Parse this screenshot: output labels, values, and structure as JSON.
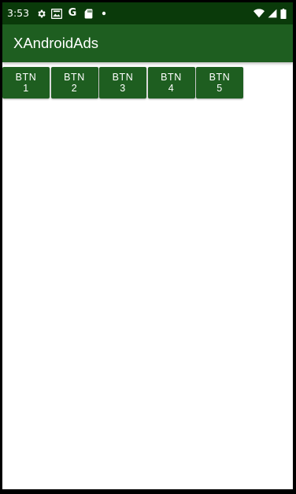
{
  "status_bar": {
    "time": "3:53",
    "left_icons": [
      "gear-icon",
      "gallery-icon",
      "google-icon",
      "sd-card-icon",
      "dot-icon"
    ],
    "right_icons": [
      "wifi-icon",
      "cell-signal-icon",
      "battery-icon"
    ],
    "google_glyph": "G"
  },
  "app_bar": {
    "title": "XAndroidAds"
  },
  "buttons": [
    {
      "line1": "BTN",
      "line2": "1"
    },
    {
      "line1": "BTN",
      "line2": "2"
    },
    {
      "line1": "BTN",
      "line2": "3"
    },
    {
      "line1": "BTN",
      "line2": "4"
    },
    {
      "line1": "BTN",
      "line2": "5"
    }
  ],
  "colors": {
    "status_bar": "#0a3a0a",
    "app_bar": "#1e5e20",
    "button": "#1e5e20",
    "text_on_primary": "#ffffff",
    "background": "#ffffff"
  }
}
